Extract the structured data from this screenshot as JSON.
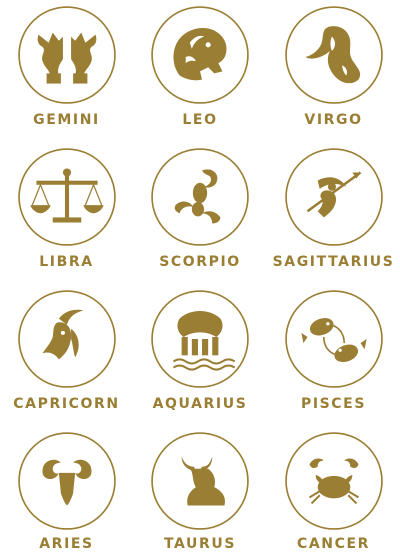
{
  "accent_color": "#9a7e34",
  "signs": [
    {
      "label": "GEMINI",
      "icon": "gemini-twins-icon"
    },
    {
      "label": "LEO",
      "icon": "leo-lion-icon"
    },
    {
      "label": "VIRGO",
      "icon": "virgo-maiden-icon"
    },
    {
      "label": "LIBRA",
      "icon": "libra-scales-icon"
    },
    {
      "label": "SCORPIO",
      "icon": "scorpio-scorpion-icon"
    },
    {
      "label": "SAGITTARIUS",
      "icon": "sagittarius-archer-icon"
    },
    {
      "label": "CAPRICORN",
      "icon": "capricorn-goat-icon"
    },
    {
      "label": "AQUARIUS",
      "icon": "aquarius-water-bearer-icon"
    },
    {
      "label": "PISCES",
      "icon": "pisces-fish-icon"
    },
    {
      "label": "ARIES",
      "icon": "aries-ram-icon"
    },
    {
      "label": "TAURUS",
      "icon": "taurus-bull-icon"
    },
    {
      "label": "CANCER",
      "icon": "cancer-crab-icon"
    }
  ]
}
